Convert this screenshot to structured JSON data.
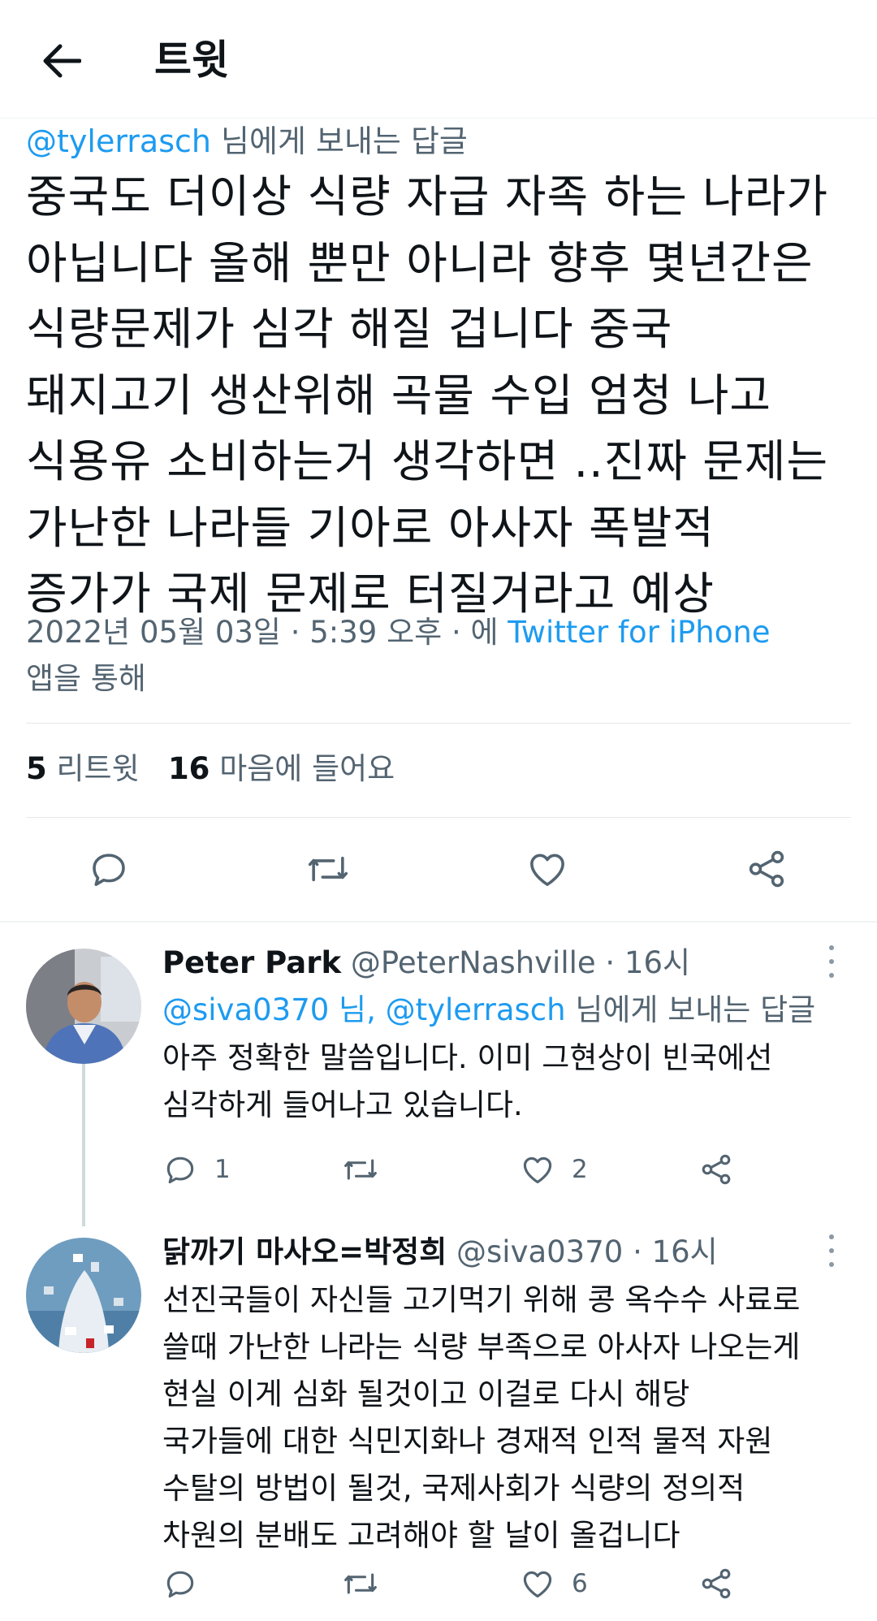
{
  "header": {
    "title": "트윗"
  },
  "tweet": {
    "reply_prefix": "@tylerrasch",
    "reply_suffix": " 님에게 보내는 답글",
    "text": "중국도 더이상 식량 자급 자족 하는 나라가\n아닙니다 올해 뿐만 아니라 향후 몇년간은\n식량문제가 심각 해질 겁니다 중국\n돼지고기 생산위해 곡물 수입 엄청 나고\n식용유 소비하는거 생각하면 ..진짜 문제는\n가난한 나라들 기아로 아사자 폭발적\n증가가 국제 문제로 터질거라고 예상",
    "timestamp": "2022년 05월 03일 · 5:39 오후 · 에 ",
    "via_app": "Twitter for iPhone",
    "via_suffix": "앱을 통해",
    "retweet_count": "5",
    "retweet_label": " 리트윗",
    "like_count": "16",
    "like_label": " 마음에 들어요"
  },
  "replies": [
    {
      "name": "Peter Park",
      "handle": "@PeterNashville · 16시",
      "reply_to": "@siva0370 님, @tylerrasch",
      "reply_to_suffix": " 님에게 보내는 답글",
      "text": "아주 정확한 말씀입니다. 이미 그현상이 빈국에선\n심각하게 들어나고 있습니다.",
      "reply_count": "1",
      "retweet_count": "",
      "like_count": "2"
    },
    {
      "name": "닭까기 마사오=박정희",
      "handle": "@siva0370 · 16시",
      "text": "선진국들이 자신들 고기먹기 위해 콩 옥수수 사료로\n쓸때 가난한 나라는 식량 부족으로 아사자 나오는게\n현실 이게 심화 될것이고 이걸로 다시 해당\n국가들에 대한 식민지화나 경재적 인적 물적 자원\n수탈의 방법이 될것, 국제사회가 식량의 정의적\n차원의 분배도 고려해야 할 날이 올겁니다",
      "reply_count": "",
      "retweet_count": "",
      "like_count": "6"
    }
  ],
  "colors": {
    "accent": "#1d9bf0",
    "muted": "#536471",
    "text": "#0f1419"
  },
  "icons": [
    "back-arrow-icon",
    "reply-icon",
    "retweet-icon",
    "like-icon",
    "share-icon",
    "more-icon"
  ]
}
